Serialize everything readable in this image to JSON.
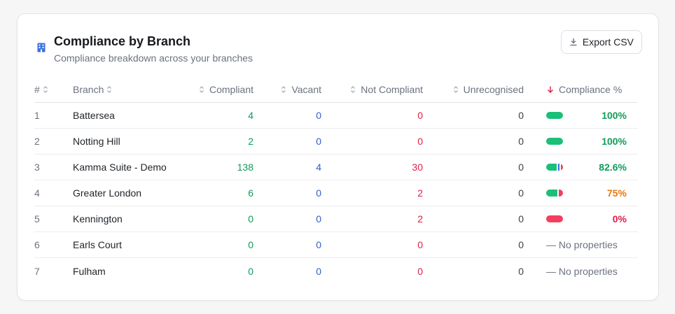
{
  "card": {
    "title": "Compliance by Branch",
    "subtitle": "Compliance breakdown across your branches",
    "title_icon": "building-icon",
    "export_label": "Export CSV",
    "export_icon": "download-icon"
  },
  "table": {
    "headers": {
      "num": "#",
      "branch": "Branch",
      "compliant": "Compliant",
      "vacant": "Vacant",
      "not_compliant": "Not Compliant",
      "unrecognised": "Unrecognised",
      "compliance_pct": "Compliance %"
    },
    "sorted_column": "compliance_pct",
    "sort_direction": "descending",
    "rows": [
      {
        "num": "1",
        "branch": "Battersea",
        "compliant": "4",
        "vacant": "0",
        "not_compliant": "0",
        "unrecognised": "0",
        "pct": "100%",
        "pct_color": "green",
        "bar": {
          "compliant": 1.0,
          "vacant": 0,
          "not_compliant": 0
        }
      },
      {
        "num": "2",
        "branch": "Notting Hill",
        "compliant": "2",
        "vacant": "0",
        "not_compliant": "0",
        "unrecognised": "0",
        "pct": "100%",
        "pct_color": "green",
        "bar": {
          "compliant": 1.0,
          "vacant": 0,
          "not_compliant": 0
        }
      },
      {
        "num": "3",
        "branch": "Kamma Suite - Demo",
        "compliant": "138",
        "vacant": "4",
        "not_compliant": "30",
        "unrecognised": "0",
        "pct": "82.6%",
        "pct_color": "green",
        "bar": {
          "compliant": 0.8,
          "vacant": 0.03,
          "not_compliant": 0.17
        }
      },
      {
        "num": "4",
        "branch": "Greater London",
        "compliant": "6",
        "vacant": "0",
        "not_compliant": "2",
        "unrecognised": "0",
        "pct": "75%",
        "pct_color": "orange",
        "bar": {
          "compliant": 0.75,
          "vacant": 0,
          "not_compliant": 0.25
        }
      },
      {
        "num": "5",
        "branch": "Kennington",
        "compliant": "0",
        "vacant": "0",
        "not_compliant": "2",
        "unrecognised": "0",
        "pct": "0%",
        "pct_color": "red",
        "bar": {
          "compliant": 0,
          "vacant": 0,
          "not_compliant": 1.0
        }
      },
      {
        "num": "6",
        "branch": "Earls Court",
        "compliant": "0",
        "vacant": "0",
        "not_compliant": "0",
        "unrecognised": "0",
        "pct": "— No properties",
        "pct_color": "none",
        "bar": null
      },
      {
        "num": "7",
        "branch": "Fulham",
        "compliant": "0",
        "vacant": "0",
        "not_compliant": "0",
        "unrecognised": "0",
        "pct": "— No properties",
        "pct_color": "none",
        "bar": null
      }
    ]
  },
  "colors": {
    "compliant": "#1bbf78",
    "vacant": "#3b6fe0",
    "not_compliant": "#f43f5e",
    "accent": "#2f5fd0"
  }
}
